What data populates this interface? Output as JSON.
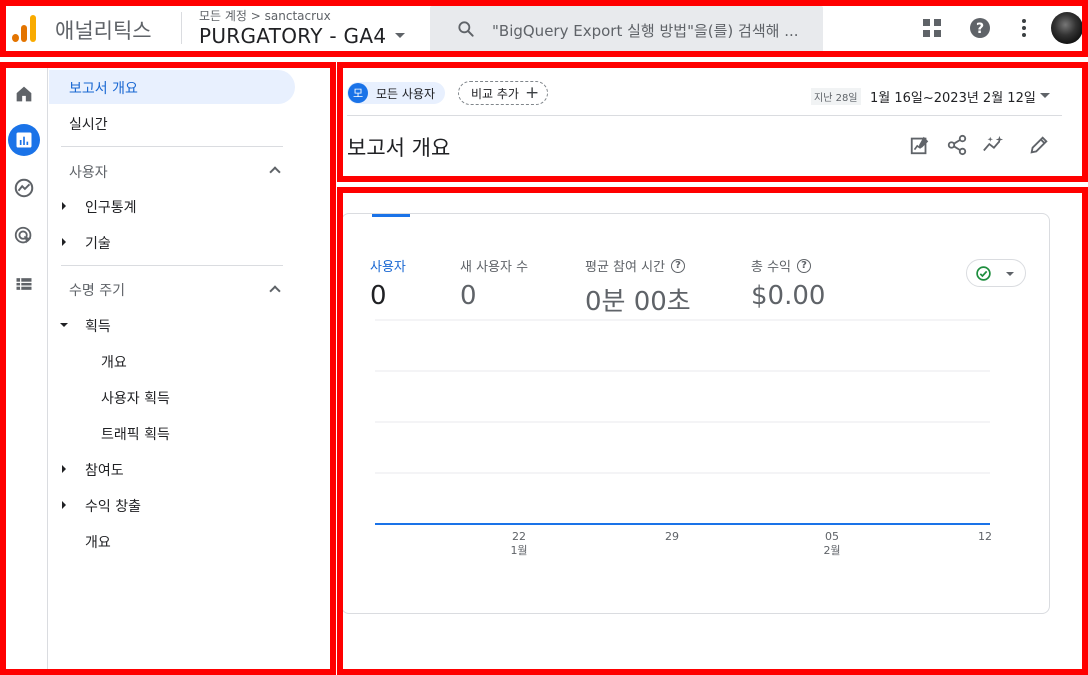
{
  "header": {
    "app_name": "애널리틱스",
    "account_breadcrumb": "모든 계정 > sanctacrux",
    "property_name": "PURGATORY - GA4",
    "search_placeholder": "\"BigQuery Export 실행 방법\"을(를) 검색해 ..."
  },
  "rail": {
    "items": [
      {
        "icon": "home-icon",
        "active": false
      },
      {
        "icon": "reports-icon",
        "active": true
      },
      {
        "icon": "explore-icon",
        "active": false
      },
      {
        "icon": "advertising-icon",
        "active": false
      },
      {
        "icon": "configure-icon",
        "active": false
      }
    ]
  },
  "nav": {
    "reports_snapshot": "보고서 개요",
    "realtime": "실시간",
    "user_section": "사용자",
    "demographics": "인구통계",
    "tech": "기술",
    "lifecycle_section": "수명 주기",
    "acquisition": "획득",
    "acq_overview": "개요",
    "user_acquisition": "사용자 획득",
    "traffic_acquisition": "트래픽 획득",
    "engagement": "참여도",
    "monetization": "수익 창출",
    "retention": "개요"
  },
  "topbar": {
    "segment_avatar": "모",
    "segment_label": "모든 사용자",
    "add_comparison": "비교 추가",
    "range_tag": "지난 28일",
    "date_range": "1월 16일~2023년 2월 12일",
    "page_title": "보고서 개요"
  },
  "card": {
    "metrics": [
      {
        "label": "사용자",
        "value": "0",
        "help": false,
        "active": true
      },
      {
        "label": "새 사용자 수",
        "value": "0",
        "help": false,
        "active": false
      },
      {
        "label": "평균 참여 시간",
        "value": "0분 00초",
        "help": true,
        "active": false
      },
      {
        "label": "총 수익",
        "value": "$0.00",
        "help": true,
        "active": false
      }
    ]
  },
  "chart_data": {
    "type": "line",
    "x_ticks": [
      {
        "day": "22",
        "month": "1월"
      },
      {
        "day": "29",
        "month": ""
      },
      {
        "day": "05",
        "month": "2월"
      },
      {
        "day": "12",
        "month": ""
      }
    ],
    "series": [
      {
        "values": [
          0,
          0
        ]
      }
    ],
    "line_color": "#1a73e8"
  }
}
